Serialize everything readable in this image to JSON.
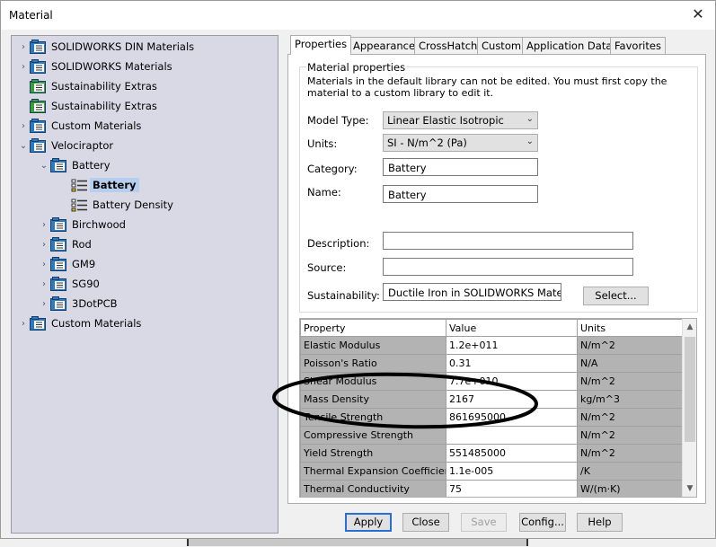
{
  "window": {
    "title": "Material",
    "close_glyph": "✕"
  },
  "tree": {
    "items": [
      {
        "label": "SOLIDWORKS DIN Materials",
        "icon": "library-icon",
        "expander": "›"
      },
      {
        "label": "SOLIDWORKS Materials",
        "icon": "library-icon",
        "expander": "›"
      },
      {
        "label": "Sustainability Extras",
        "icon": "sustainability-library-icon",
        "expander": ""
      },
      {
        "label": "Sustainability Extras",
        "icon": "sustainability-library-icon",
        "expander": ""
      },
      {
        "label": "Custom Materials",
        "icon": "library-icon",
        "expander": "›"
      },
      {
        "label": "Velociraptor",
        "icon": "library-icon",
        "expander": "⌄"
      },
      {
        "label": "Battery",
        "icon": "category-icon",
        "expander": "⌄"
      },
      {
        "label": "Battery",
        "icon": "material-icon",
        "expander": "",
        "selected": true
      },
      {
        "label": "Battery Density",
        "icon": "material-icon",
        "expander": ""
      },
      {
        "label": "Birchwood",
        "icon": "category-icon",
        "expander": "›"
      },
      {
        "label": "Rod",
        "icon": "category-icon",
        "expander": "›"
      },
      {
        "label": "GM9",
        "icon": "category-icon",
        "expander": "›"
      },
      {
        "label": "SG90",
        "icon": "category-icon",
        "expander": "›"
      },
      {
        "label": "3DotPCB",
        "icon": "category-icon",
        "expander": "›"
      },
      {
        "label": "Custom Materials",
        "icon": "library-icon",
        "expander": "›"
      }
    ]
  },
  "tabs": [
    "Properties",
    "Appearance",
    "CrossHatch",
    "Custom",
    "Application Data",
    "Favorites"
  ],
  "properties": {
    "group_title": "Material properties",
    "note": "Materials in the default library can not be edited. You must first copy the material to a custom library to edit it.",
    "model_type_label": "Model Type:",
    "model_type_value": "Linear Elastic Isotropic",
    "units_label": "Units:",
    "units_value": "SI - N/m^2 (Pa)",
    "category_label": "Category:",
    "category_value": "Battery",
    "name_label": "Name:",
    "name_value": "Battery",
    "description_label": "Description:",
    "description_value": "",
    "source_label": "Source:",
    "source_value": "",
    "sustainability_label": "Sustainability:",
    "sustainability_value": "Ductile Iron in SOLIDWORKS Material",
    "select_button": "Select..."
  },
  "grid": {
    "headers": [
      "Property",
      "Value",
      "Units"
    ],
    "rows": [
      [
        "Elastic Modulus",
        "1.2e+011",
        "N/m^2"
      ],
      [
        "Poisson's Ratio",
        "0.31",
        "N/A"
      ],
      [
        "Shear Modulus",
        "7.7e+010",
        "N/m^2"
      ],
      [
        "Mass Density",
        "2167",
        "kg/m^3"
      ],
      [
        "Tensile Strength",
        "861695000",
        "N/m^2"
      ],
      [
        "Compressive Strength",
        "",
        "N/m^2"
      ],
      [
        "Yield Strength",
        "551485000",
        "N/m^2"
      ],
      [
        "Thermal Expansion Coefficient",
        "1.1e-005",
        "/K"
      ],
      [
        "Thermal Conductivity",
        "75",
        "W/(m·K)"
      ]
    ]
  },
  "buttons": {
    "apply": "Apply",
    "close": "Close",
    "save": "Save",
    "config": "Config...",
    "help": "Help"
  },
  "colors": {
    "tree_bg": "#d9d9e6",
    "selection": "#b7cfee",
    "default_button_border": "#2a6fd6",
    "icon_blue": "#2b7bc4",
    "icon_green": "#3aa03a"
  }
}
